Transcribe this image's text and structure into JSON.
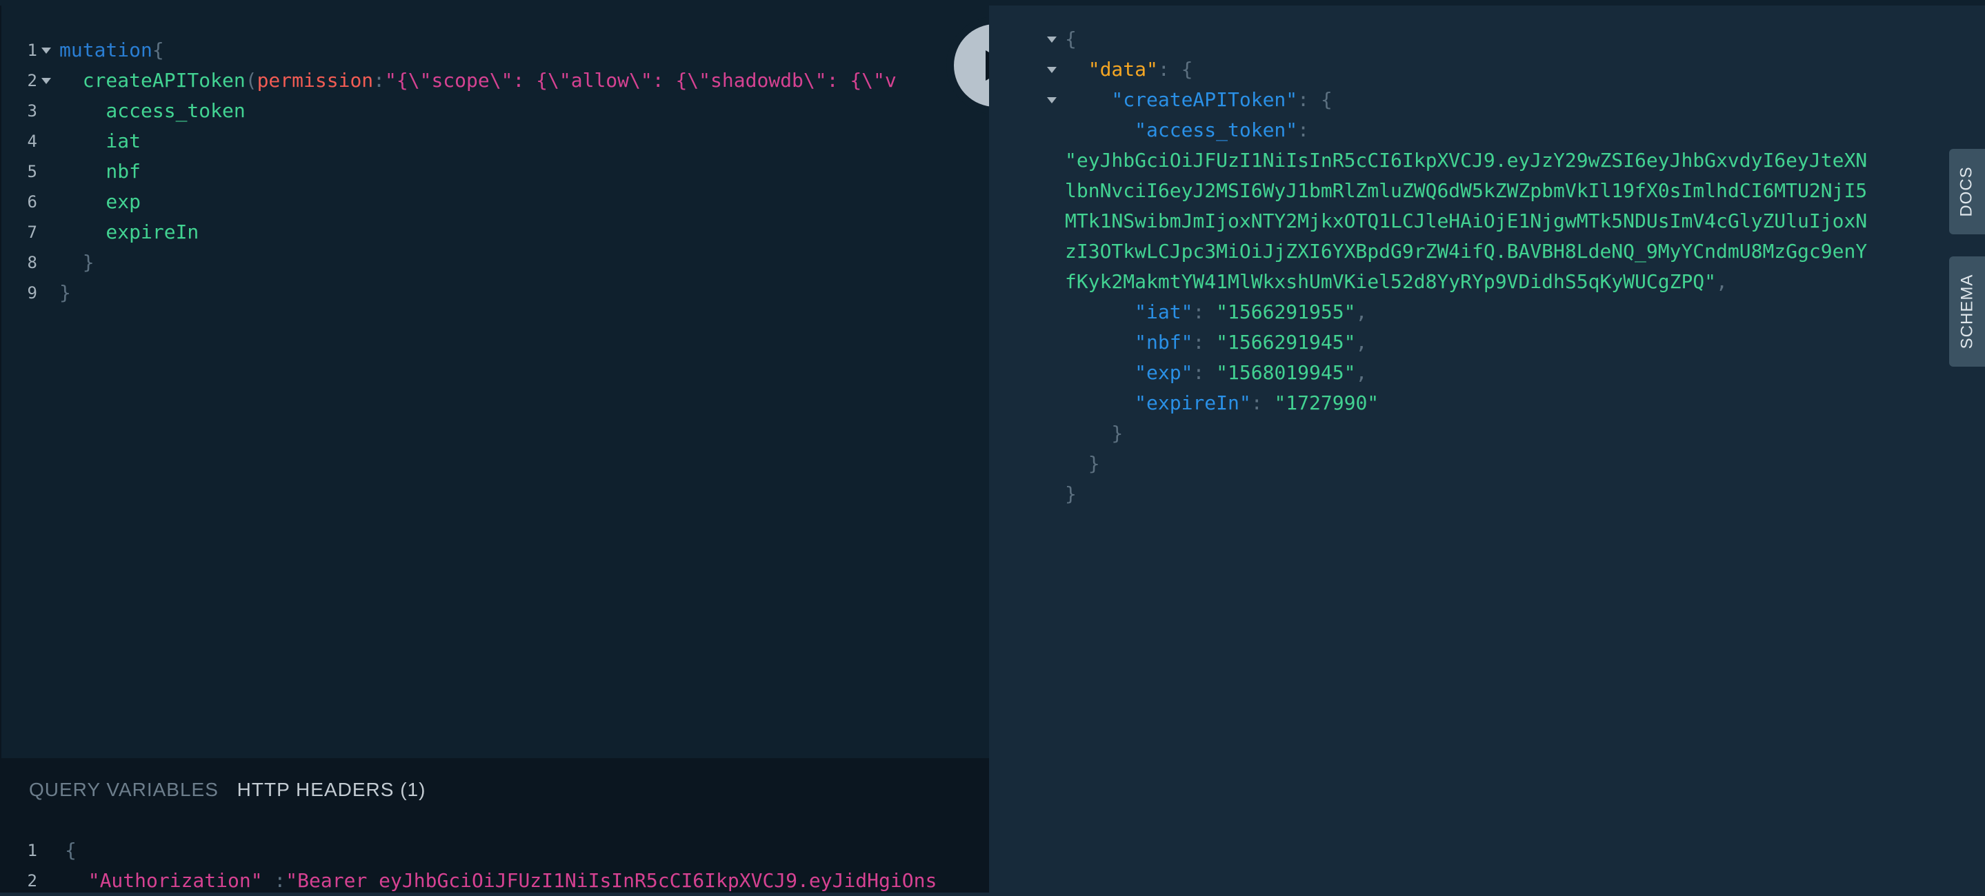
{
  "editor": {
    "lines": [
      {
        "n": "1",
        "fold": true,
        "parts": [
          {
            "c": "kw",
            "t": "mutation"
          },
          {
            "c": "punc",
            "t": "{"
          }
        ]
      },
      {
        "n": "2",
        "fold": true,
        "parts": [
          {
            "c": "fn",
            "t": "  createAPIToken"
          },
          {
            "c": "punc",
            "t": "("
          },
          {
            "c": "arg",
            "t": "permission"
          },
          {
            "c": "punc",
            "t": ":"
          },
          {
            "c": "str",
            "t": "\"{\\\"scope\\\": {\\\"allow\\\": {\\\"shadowdb\\\": {\\\"v"
          }
        ]
      },
      {
        "n": "3",
        "fold": false,
        "parts": [
          {
            "c": "fld",
            "t": "    access_token"
          }
        ]
      },
      {
        "n": "4",
        "fold": false,
        "parts": [
          {
            "c": "fld",
            "t": "    iat"
          }
        ]
      },
      {
        "n": "5",
        "fold": false,
        "parts": [
          {
            "c": "fld",
            "t": "    nbf"
          }
        ]
      },
      {
        "n": "6",
        "fold": false,
        "parts": [
          {
            "c": "fld",
            "t": "    exp"
          }
        ]
      },
      {
        "n": "7",
        "fold": false,
        "parts": [
          {
            "c": "fld",
            "t": "    expireIn"
          }
        ]
      },
      {
        "n": "8",
        "fold": false,
        "parts": [
          {
            "c": "punc",
            "t": "  }"
          }
        ]
      },
      {
        "n": "9",
        "fold": false,
        "parts": [
          {
            "c": "punc",
            "t": "}"
          }
        ]
      }
    ]
  },
  "run_button": {
    "icon": "play-icon"
  },
  "bottom_panel": {
    "tabs": [
      {
        "label": "QUERY VARIABLES",
        "active": false
      },
      {
        "label": "HTTP HEADERS (1)",
        "active": true
      }
    ],
    "lines": [
      {
        "n": "1",
        "parts": [
          {
            "c": "punc",
            "t": "{"
          }
        ]
      },
      {
        "n": "2",
        "parts": [
          {
            "c": "str",
            "t": "  \"Authorization\""
          },
          {
            "c": "punc",
            "t": " :"
          },
          {
            "c": "str",
            "t": "\"Bearer eyJhbGciOiJFUzI1NiIsInR5cCI6IkpXVCJ9.eyJidHgiOns"
          }
        ]
      }
    ]
  },
  "result": {
    "lines": [
      {
        "fold": true,
        "parts": [
          {
            "c": "punc",
            "t": "{"
          }
        ]
      },
      {
        "fold": true,
        "parts": [
          {
            "c": "key-orange",
            "t": "  \"data\""
          },
          {
            "c": "punc",
            "t": ": {"
          }
        ]
      },
      {
        "fold": true,
        "parts": [
          {
            "c": "key-blue",
            "t": "    \"createAPIToken\""
          },
          {
            "c": "punc",
            "t": ": {"
          }
        ]
      },
      {
        "fold": false,
        "parts": [
          {
            "c": "key-blue",
            "t": "      \"access_token\""
          },
          {
            "c": "punc",
            "t": ":"
          }
        ]
      },
      {
        "fold": false,
        "parts": [
          {
            "c": "val",
            "t": "\"eyJhbGciOiJFUzI1NiIsInR5cCI6IkpXVCJ9.eyJzY29wZSI6eyJhbGxvdyI6eyJteXN"
          }
        ]
      },
      {
        "fold": false,
        "parts": [
          {
            "c": "val",
            "t": "lbnNvciI6eyJ2MSI6WyJ1bmRlZmluZWQ6dW5kZWZpbmVkIl19fX0sImlhdCI6MTU2NjI5"
          }
        ]
      },
      {
        "fold": false,
        "parts": [
          {
            "c": "val",
            "t": "MTk1NSwibmJmIjoxNTY2MjkxOTQ1LCJleHAiOjE1NjgwMTk5NDUsImV4cGlyZUluIjoxN"
          }
        ]
      },
      {
        "fold": false,
        "parts": [
          {
            "c": "val",
            "t": "zI3OTkwLCJpc3MiOiJjZXI6YXBpdG9rZW4ifQ.BAVBH8LdeNQ_9MyYCndmU8MzGgc9enY"
          }
        ]
      },
      {
        "fold": false,
        "parts": [
          {
            "c": "val",
            "t": "fKyk2MakmtYW41MlWkxshUmVKiel52d8YyRYp9VDidhS5qKyWUCgZPQ\""
          },
          {
            "c": "punc",
            "t": ","
          }
        ]
      },
      {
        "fold": false,
        "parts": [
          {
            "c": "key-blue",
            "t": "      \"iat\""
          },
          {
            "c": "punc",
            "t": ": "
          },
          {
            "c": "val",
            "t": "\"1566291955\""
          },
          {
            "c": "punc",
            "t": ","
          }
        ]
      },
      {
        "fold": false,
        "parts": [
          {
            "c": "key-blue",
            "t": "      \"nbf\""
          },
          {
            "c": "punc",
            "t": ": "
          },
          {
            "c": "val",
            "t": "\"1566291945\""
          },
          {
            "c": "punc",
            "t": ","
          }
        ]
      },
      {
        "fold": false,
        "parts": [
          {
            "c": "key-blue",
            "t": "      \"exp\""
          },
          {
            "c": "punc",
            "t": ": "
          },
          {
            "c": "val",
            "t": "\"1568019945\""
          },
          {
            "c": "punc",
            "t": ","
          }
        ]
      },
      {
        "fold": false,
        "parts": [
          {
            "c": "key-blue",
            "t": "      \"expireIn\""
          },
          {
            "c": "punc",
            "t": ": "
          },
          {
            "c": "val",
            "t": "\"1727990\""
          }
        ]
      },
      {
        "fold": false,
        "parts": [
          {
            "c": "punc",
            "t": "    }"
          }
        ]
      },
      {
        "fold": false,
        "parts": [
          {
            "c": "punc",
            "t": "  }"
          }
        ]
      },
      {
        "fold": false,
        "parts": [
          {
            "c": "punc",
            "t": "}"
          }
        ]
      }
    ]
  },
  "side_tabs": {
    "docs": "DOCS",
    "schema": "SCHEMA"
  }
}
